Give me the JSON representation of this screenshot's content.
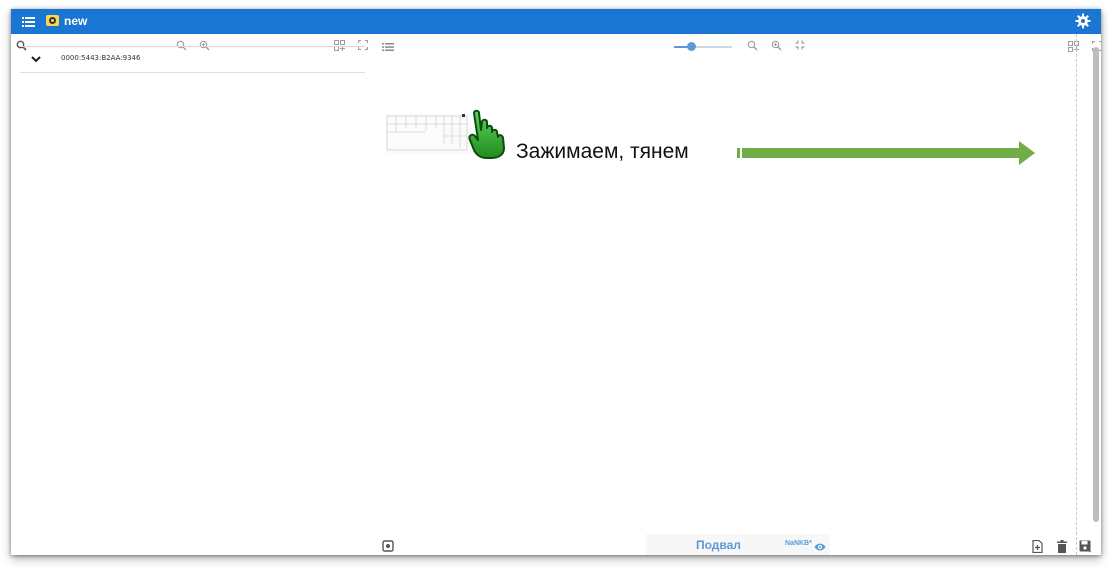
{
  "app": {
    "title": "new"
  },
  "tree": {
    "items": [
      {
        "label": "0000:5443:B2AA:9346"
      }
    ]
  },
  "view": {
    "zoom_slider_value": 0.3
  },
  "instruction": {
    "text": "Зажимаем, тянем"
  },
  "floor": {
    "name": "Подвал",
    "badge": "NaNKB*"
  },
  "colors": {
    "topbar": "#1976d2",
    "accent": "#5b9bd5",
    "arrow": "#70ad47",
    "hand": "#2ca02c"
  },
  "icons": [
    "menu-icon",
    "logo-icon",
    "gear-icon",
    "search-icon",
    "zoom-out-icon",
    "zoom-in-icon",
    "add-grid-icon",
    "fullscreen-icon",
    "chevron-down-icon",
    "list-icon",
    "fit-icon",
    "settings-square-icon",
    "add-file-icon",
    "delete-icon",
    "save-icon",
    "eye-icon",
    "hand-cursor-icon"
  ]
}
